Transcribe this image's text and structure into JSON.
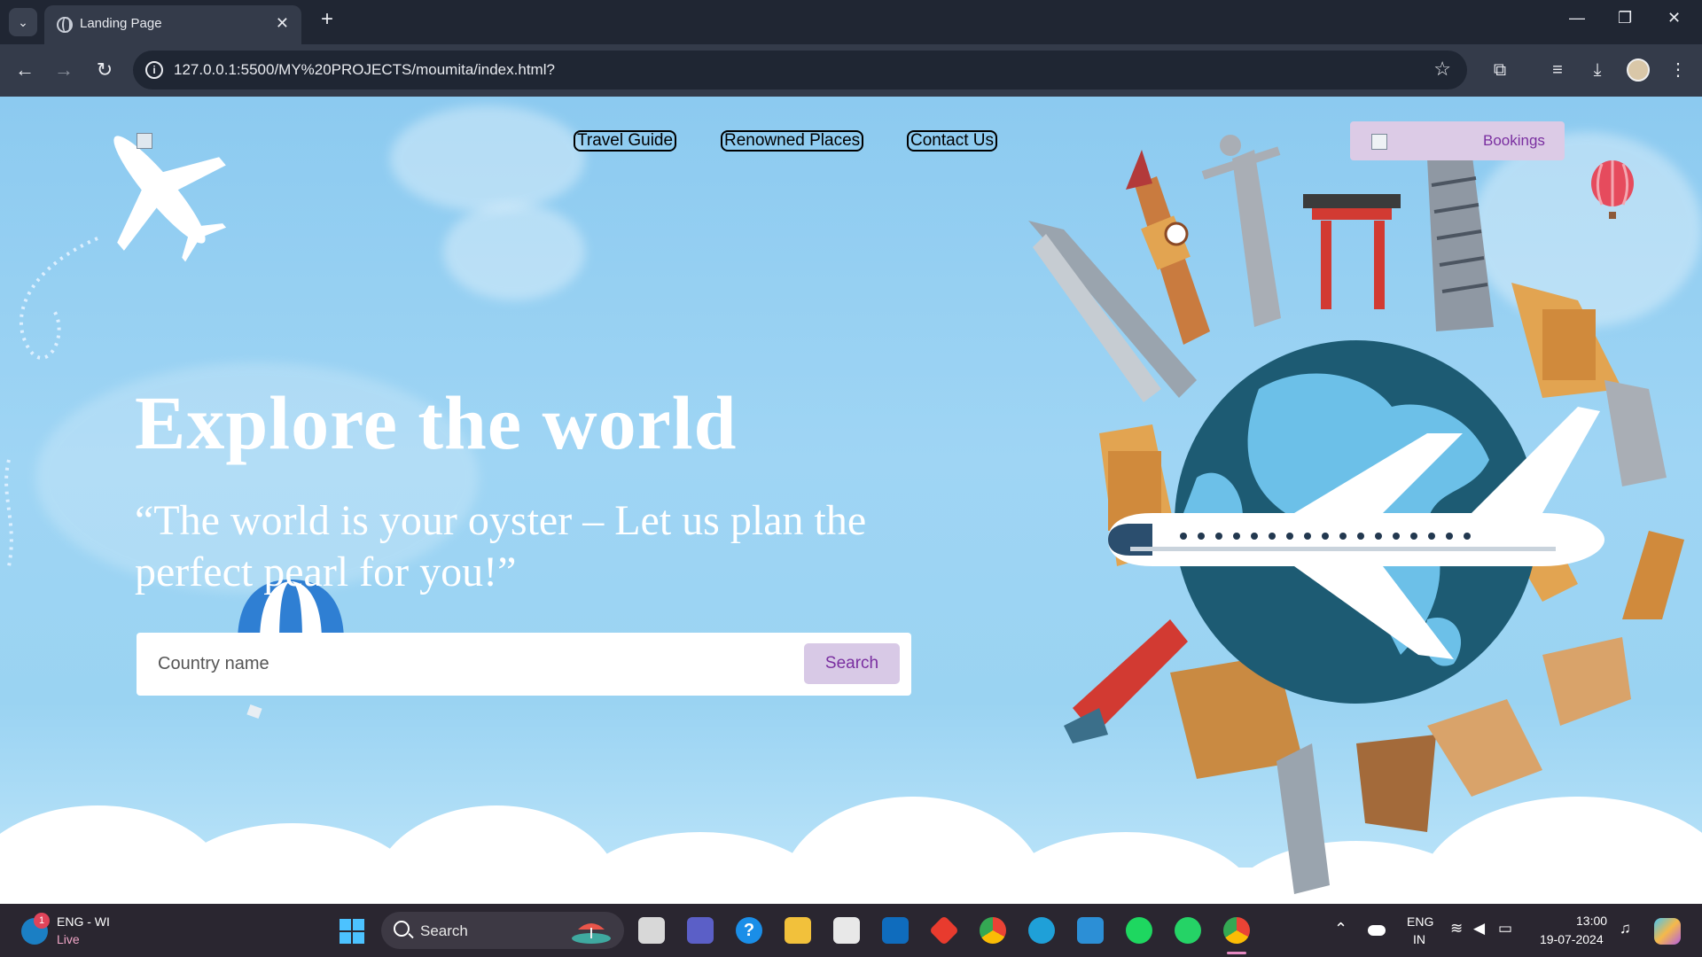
{
  "browser": {
    "tab_title": "Landing Page",
    "url": "127.0.0.1:5500/MY%20PROJECTS/moumita/index.html?",
    "tab_close": "✕",
    "new_tab": "+",
    "minimize": "—",
    "restore": "❐",
    "close": "✕"
  },
  "nav": {
    "links": [
      "Travel Guide",
      "Renowned Places",
      "Contact Us"
    ],
    "bookings_label": "Bookings"
  },
  "hero": {
    "heading": "Explore the world",
    "quote": "“The world is your oyster – Let us plan the perfect pearl for you!”"
  },
  "search": {
    "placeholder": "Country name",
    "button_label": "Search"
  },
  "taskbar": {
    "weather_badge": "1",
    "weather_text": "ENG - WI",
    "weather_sub": "Live",
    "search_label": "Search",
    "lang_top": "ENG",
    "lang_bottom": "IN",
    "time": "13:00",
    "date": "19-07-2024"
  },
  "colors": {
    "bookings_bg": "#dccbe6",
    "accent_purple": "#7a2fa0",
    "sky": "#9fd5f4"
  }
}
